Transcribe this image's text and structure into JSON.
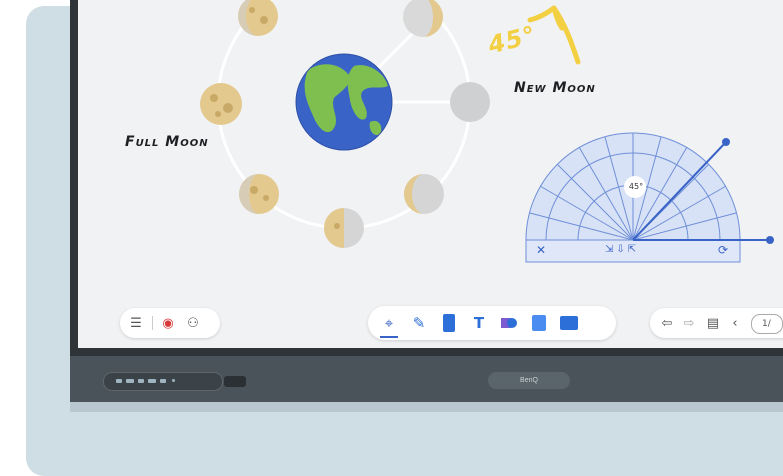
{
  "whiteboard": {
    "label_new_moon": "New Moon",
    "label_full_moon": "Full Moon",
    "angle_note": "45°"
  },
  "protractor": {
    "angle_badge": "45°",
    "close_icon": "close-icon",
    "rotate_icon": "rotate-icon"
  },
  "left_toolbar": {
    "icons": [
      "menu-icon",
      "record-icon",
      "add-user-icon"
    ]
  },
  "center_toolbar": {
    "tools": [
      "select-tool",
      "pen-tool",
      "eraser-tool",
      "text-tool",
      "shapes-tool",
      "image-tool",
      "toolbox-tool"
    ]
  },
  "right_toolbar": {
    "icons": [
      "undo-icon",
      "redo-icon",
      "notes-icon",
      "previous-page-icon"
    ],
    "page_indicator": "1/"
  },
  "bezel": {
    "brand": "BenQ"
  },
  "colors": {
    "accent": "#3a63c7",
    "handwriting_yellow": "#f3cf42",
    "protractor_blue": "#6f8fd8"
  }
}
